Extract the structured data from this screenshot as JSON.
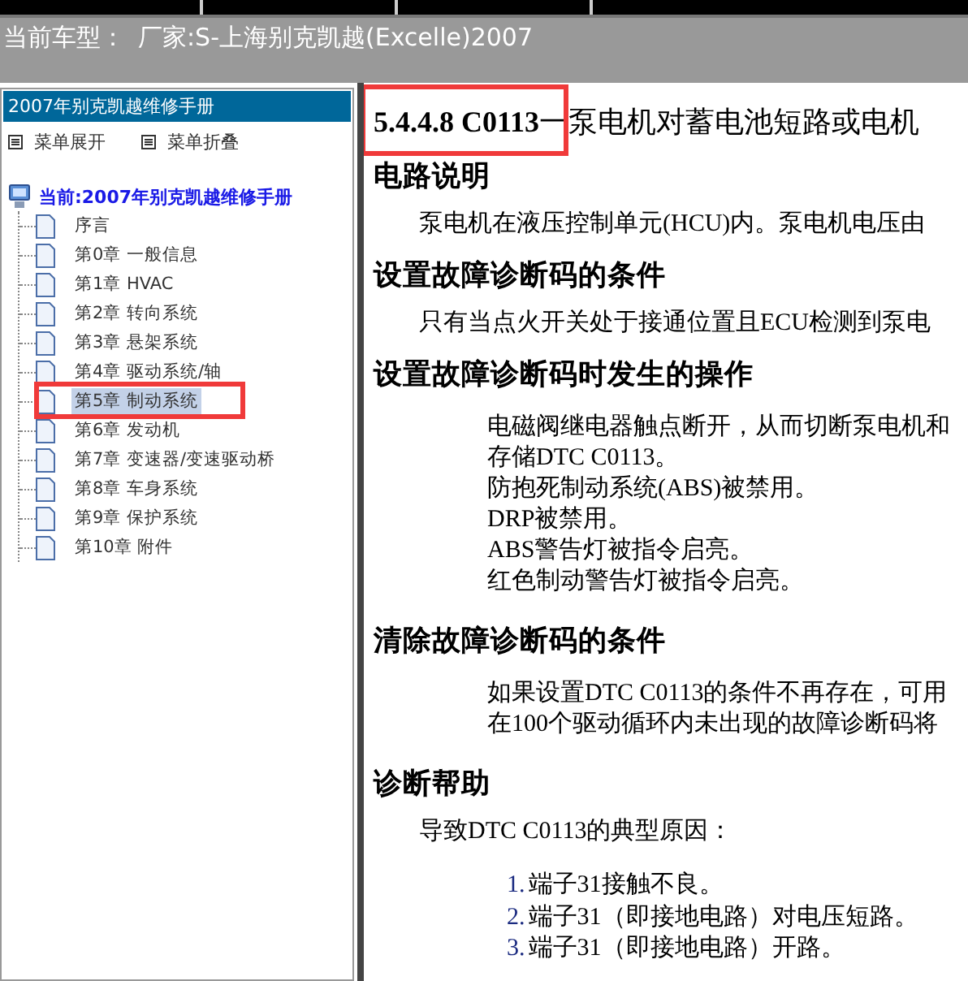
{
  "header": {
    "label": "当前车型：",
    "vehicle": "厂家:S-上海别克凯越(Excelle)2007"
  },
  "sidebar": {
    "title": "2007年别克凯越维修手册",
    "actions": [
      "菜单展开",
      "菜单折叠"
    ],
    "tree": {
      "label": "当前:2007年别克凯越维修手册",
      "children": [
        {
          "label": "序言",
          "selected": false,
          "annotated": false
        },
        {
          "label": "第0章 一般信息",
          "selected": false,
          "annotated": false
        },
        {
          "label": "第1章 HVAC",
          "selected": false,
          "annotated": false
        },
        {
          "label": "第2章 转向系统",
          "selected": false,
          "annotated": false
        },
        {
          "label": "第3章 悬架系统",
          "selected": false,
          "annotated": false
        },
        {
          "label": "第4章 驱动系统/轴",
          "selected": false,
          "annotated": false
        },
        {
          "label": "第5章 制动系统",
          "selected": true,
          "annotated": true
        },
        {
          "label": "第6章 发动机",
          "selected": false,
          "annotated": false
        },
        {
          "label": "第7章 变速器/变速驱动桥",
          "selected": false,
          "annotated": false
        },
        {
          "label": "第8章 车身系统",
          "selected": false,
          "annotated": false
        },
        {
          "label": "第9章 保护系统",
          "selected": false,
          "annotated": false
        },
        {
          "label": "第10章 附件",
          "selected": false,
          "annotated": false
        }
      ]
    }
  },
  "document": {
    "title": "5.4.4.8 C0113",
    "title_rest": "一泵电机对蓄电池短路或电机",
    "title_annotated": true,
    "sections": [
      {
        "heading": "电路说明",
        "blocks": [
          {
            "kind": "para",
            "lines": [
              "泵电机在液压控制单元(HCU)内。泵电机电压由"
            ]
          }
        ]
      },
      {
        "heading": "设置故障诊断码的条件",
        "blocks": [
          {
            "kind": "para",
            "lines": [
              "只有当点火开关处于接通位置且ECU检测到泵电"
            ]
          }
        ]
      },
      {
        "heading": "设置故障诊断码时发生的操作",
        "blocks": [
          {
            "kind": "indented",
            "lines": [
              "电磁阀继电器触点断开，从而切断泵电机和",
              "存储DTC C0113。",
              "防抱死制动系统(ABS)被禁用。",
              "DRP被禁用。",
              "ABS警告灯被指令启亮。",
              "红色制动警告灯被指令启亮。"
            ]
          }
        ]
      },
      {
        "heading": "清除故障诊断码的条件",
        "blocks": [
          {
            "kind": "indented",
            "lines": [
              "如果设置DTC C0113的条件不再存在，可用",
              "在100个驱动循环内未出现的故障诊断码将"
            ]
          }
        ]
      },
      {
        "heading": "诊断帮助",
        "blocks": [
          {
            "kind": "para",
            "lines": [
              "导致DTC C0113的典型原因："
            ]
          },
          {
            "kind": "list",
            "items": [
              {
                "number": "1.",
                "text": "端子31接触不良。"
              },
              {
                "number": "2.",
                "text": "端子31（即接地电路）对电压短路。"
              },
              {
                "number": "3.",
                "text": "端子31（即接地电路）开路。"
              }
            ]
          }
        ]
      }
    ]
  }
}
